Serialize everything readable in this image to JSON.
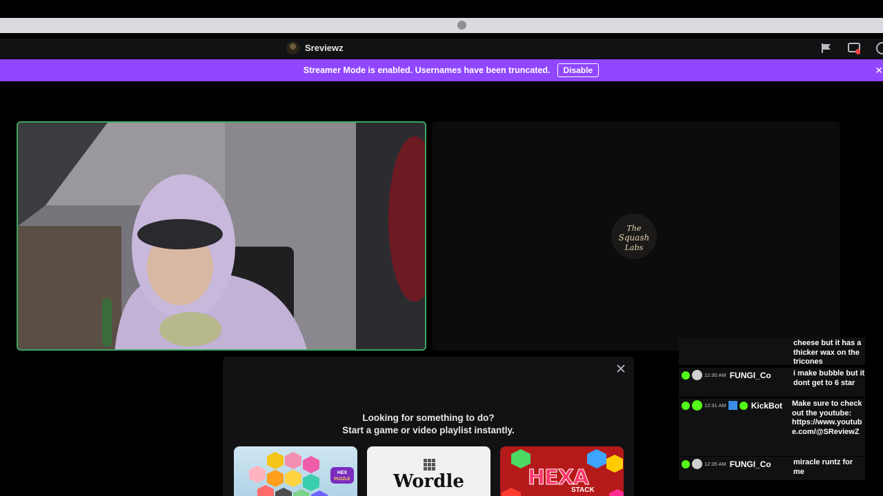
{
  "header": {
    "channel_name": "Sreviewz"
  },
  "banner": {
    "message": "Streamer Mode is enabled. Usernames have been truncated.",
    "button_label": "Disable",
    "bg_color": "#9146ff"
  },
  "activity": {
    "heading_line1": "Looking for something to do?",
    "heading_line2": "Start a game or video playlist instantly.",
    "games": [
      {
        "name": "Hex Puzzle",
        "badge": "HEX PUZZLE"
      },
      {
        "name": "Wordle"
      },
      {
        "name": "Hexa Stack",
        "title": "HEXA",
        "sub": "STACK"
      }
    ]
  },
  "chat": {
    "messages": [
      {
        "time": "",
        "user": "",
        "text": "cheese but it has a thicker wax on the tricones"
      },
      {
        "time": "12:30 AM",
        "user": "FUNGI_Co",
        "text": "i make bubble but it dont get to 6 star"
      },
      {
        "time": "12:31 AM",
        "user": "KickBot",
        "text": "Make sure to check out the youtube: https://www.youtube.com/@SReviewZ"
      },
      {
        "time": "12:35 AM",
        "user": "FUNGI_Co",
        "text": "miracle runtz for me"
      }
    ]
  },
  "logo_text": "The Squash Labs"
}
